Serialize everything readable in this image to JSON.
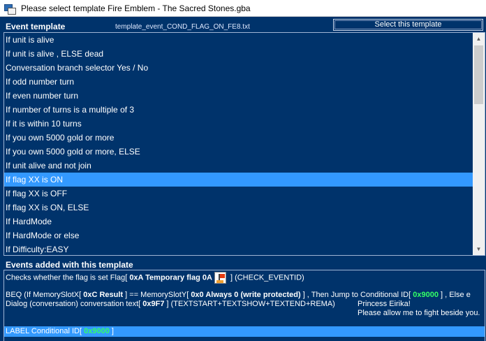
{
  "window": {
    "title": "Please select template Fire Emblem - The Sacred Stones.gba",
    "app_icon": "window-app-icon"
  },
  "template_header": {
    "label": "Event template",
    "filename": "template_event_COND_FLAG_ON_FE8.txt",
    "select_button": "Select this template"
  },
  "template_list": {
    "items": [
      "If unit is alive",
      "If unit is alive , ELSE dead",
      "Conversation branch selector Yes / No",
      "If odd number turn",
      "If even number turn",
      "If number of turns is a multiple of 3",
      "If it is within 10 turns",
      "If you own 5000 gold or more",
      "If you own 5000 gold or more, ELSE",
      "If unit alive and not join",
      "If flag XX is ON",
      "If flag XX is OFF",
      "If flag XX is ON, ELSE",
      "If HardMode",
      "If HardMode or else",
      "If Difficulty:EASY"
    ],
    "selected_index": 10,
    "scroll_up": "▲",
    "scroll_down": "▼"
  },
  "events": {
    "label": "Events added with this template",
    "line1": {
      "prefix": "Checks whether the flag is set  Flag[ ",
      "flag_value": "0xA  Temporary flag 0A",
      "suffix": " ] (CHECK_EVENTID)"
    },
    "line2": {
      "p1": "BEQ (If MemorySlotX[ ",
      "v1": "0xC  Result",
      "p2": " ]  == MemorySlotY[ ",
      "v2": "0x0  Always 0 (write protected)",
      "p3": " ] , Then Jump to  Conditional ID[ ",
      "v3": "0x9000",
      "p4": " ] , Else e"
    },
    "line3": {
      "p1": "Dialog (conversation) conversation text[ ",
      "v1": "0x9F7",
      "p2": " ] (TEXTSTART+TEXTSHOW+TEXTEND+REMA)"
    },
    "message": {
      "line1": "Princess Eirika!",
      "line2": "Please allow me to fight beside you."
    },
    "label_line": {
      "prefix": "LABEL  Conditional ID[ ",
      "value": "0x9000",
      "suffix": " ]"
    }
  }
}
